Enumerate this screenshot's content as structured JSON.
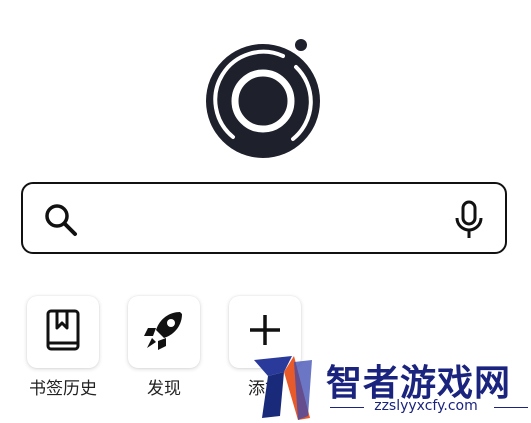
{
  "search": {
    "value": "",
    "placeholder": ""
  },
  "shortcuts": [
    {
      "label": "书签历史",
      "icon": "bookmark-icon"
    },
    {
      "label": "发现",
      "icon": "rocket-icon"
    },
    {
      "label": "添加",
      "icon": "plus-icon"
    }
  ],
  "watermark": {
    "title": "智者游戏网",
    "url": "zzslyyxcfy.com"
  },
  "colors": {
    "logo_dark": "#1e202c",
    "icon": "#111111",
    "watermark": "#1a237e"
  }
}
